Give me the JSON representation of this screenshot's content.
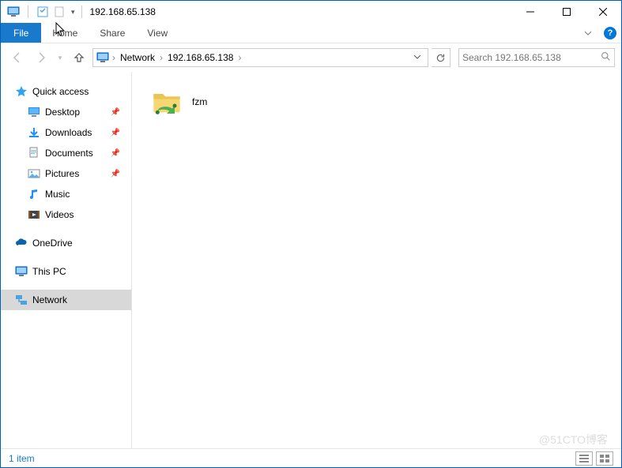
{
  "window": {
    "title": "192.168.65.138"
  },
  "ribbon": {
    "file": "File",
    "tabs": [
      "Home",
      "Share",
      "View"
    ]
  },
  "address": {
    "crumbs": [
      "Network",
      "192.168.65.138"
    ]
  },
  "search": {
    "placeholder": "Search 192.168.65.138"
  },
  "sidebar": {
    "quick_access": "Quick access",
    "items": [
      {
        "label": "Desktop",
        "pinned": true
      },
      {
        "label": "Downloads",
        "pinned": true
      },
      {
        "label": "Documents",
        "pinned": true
      },
      {
        "label": "Pictures",
        "pinned": true
      },
      {
        "label": "Music",
        "pinned": false
      },
      {
        "label": "Videos",
        "pinned": false
      }
    ],
    "onedrive": "OneDrive",
    "this_pc": "This PC",
    "network": "Network"
  },
  "content": {
    "items": [
      {
        "name": "fzm",
        "type": "network-share"
      }
    ]
  },
  "statusbar": {
    "count_text": "1 item"
  },
  "watermark": "@51CTO博客"
}
